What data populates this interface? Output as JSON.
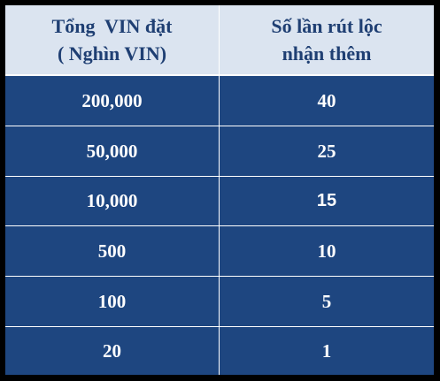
{
  "table": {
    "headers": [
      {
        "line1": "Tổng  VIN đặt",
        "line2": "( Nghìn VIN)"
      },
      {
        "line1": "Số lần rút lộc",
        "line2": "nhận thêm"
      }
    ],
    "rows": [
      {
        "total_vin": "200,000",
        "draws": "40"
      },
      {
        "total_vin": "50,000",
        "draws": "25"
      },
      {
        "total_vin": "10,000",
        "draws": "15"
      },
      {
        "total_vin": "500",
        "draws": "10"
      },
      {
        "total_vin": "100",
        "draws": "5"
      },
      {
        "total_vin": "20",
        "draws": "1"
      }
    ]
  },
  "colors": {
    "header_bg": "#dbe4f0",
    "header_text": "#1f3f73",
    "row_bg": "#1e4680",
    "row_text": "#ffffff",
    "frame": "#000000"
  }
}
